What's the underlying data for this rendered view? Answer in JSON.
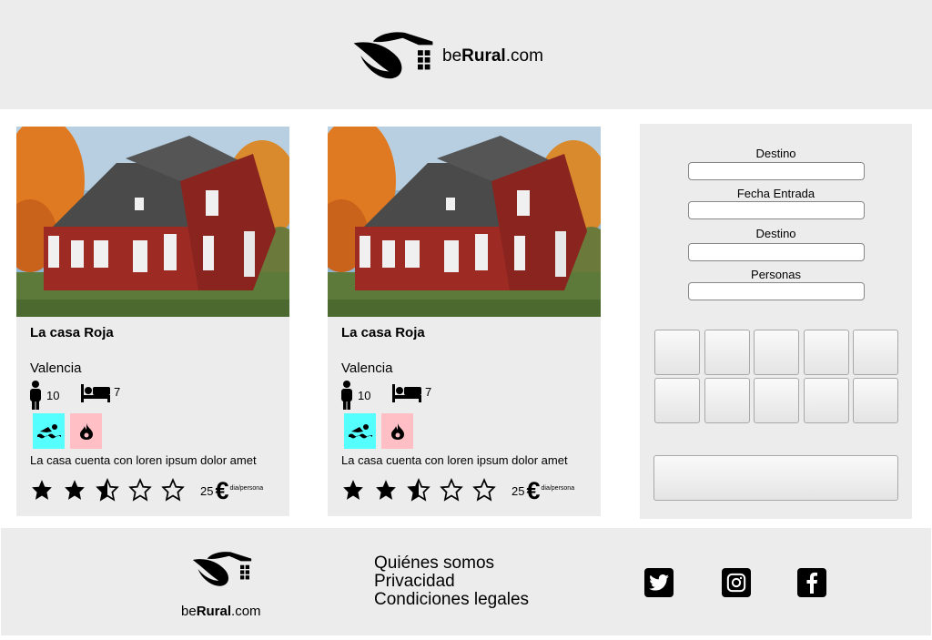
{
  "header": {
    "brand_pre": "be",
    "brand_bold": "Rural",
    "brand_post": ".com"
  },
  "cards": [
    {
      "title": "La casa Roja",
      "city": "Valencia",
      "capacity": "10",
      "beds": "7",
      "amenities": [
        "pool-icon",
        "fire-icon"
      ],
      "description": "La casa cuenta con loren ipsum dolor amet",
      "rating": 2.5,
      "rating_max": 5,
      "price": "25",
      "currency": "€",
      "price_unit": "dia/persona"
    },
    {
      "title": "La casa Roja",
      "city": "Valencia",
      "capacity": "10",
      "beds": "7",
      "amenities": [
        "pool-icon",
        "fire-icon"
      ],
      "description": "La casa cuenta con loren ipsum dolor amet",
      "rating": 2.5,
      "rating_max": 5,
      "price": "25",
      "currency": "€",
      "price_unit": "dia/persona"
    }
  ],
  "search": {
    "fields": [
      {
        "label": "Destino",
        "value": ""
      },
      {
        "label": "Fecha Entrada",
        "value": ""
      },
      {
        "label": "Destino",
        "value": ""
      },
      {
        "label": "Personas",
        "value": ""
      }
    ],
    "grid_buttons": 10,
    "submit_label": ""
  },
  "footer": {
    "brand_pre": "be",
    "brand_bold": "Rural",
    "brand_post": ".com",
    "links": [
      "Quiénes somos",
      "Privacidad",
      "Condiciones legales"
    ],
    "social": [
      "twitter-icon",
      "instagram-icon",
      "facebook-icon"
    ]
  },
  "colors": {
    "background": "#ececec",
    "pool_badge": "#55ffff",
    "fire_badge": "#ffbfc5"
  }
}
